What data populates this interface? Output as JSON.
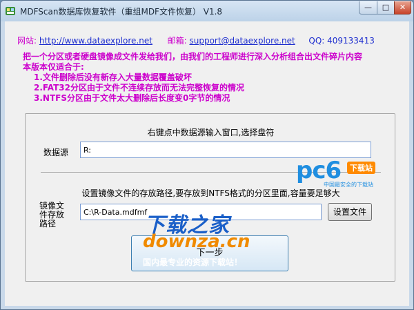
{
  "window": {
    "title": "MDFScan数据库恢复软件（重组MDF文件恢复） V1.8",
    "controls": {
      "minimize": "—",
      "maximize": "□",
      "close": "✕"
    }
  },
  "contact": {
    "website_label": "网站:",
    "website": "http://www.dataexplore.net",
    "email_label": "邮箱:",
    "email": "support@dataexplore.net",
    "qq": "QQ:  409133413"
  },
  "intro": {
    "line1": "把一个分区或者硬盘镜像成文件发给我们，由我们的工程师进行深入分析组合出文件碎片内容",
    "line2": "本版本仅适合于:",
    "items": [
      "1.文件删除后没有新存入大量数据覆盖破坏",
      "2.FAT32分区由于文件不连续存放而无法完整恢复的情况",
      "3.NTFS分区由于文件太大删除后长度变0字节的情况"
    ]
  },
  "panel": {
    "hint_source": "右键点中数据源输入窗口,选择盘符",
    "source_label": "数据源",
    "source_value": "R:",
    "hint_path": "设置镜像文件的存放路径,要存放到NTFS格式的分区里面,容量要足够大",
    "path_label": "镜像文件存放路径",
    "path_value": "C:\\R-Data.mdfmf",
    "browse_label": "设置文件",
    "next_label": "下一步"
  },
  "watermarks": {
    "pc6_logo": "pc6",
    "pc6_tag": "下载站",
    "pc6_slogan": "中国最安全的下载站",
    "xzj_line1": "下载之家",
    "xzj_line2": "downza.cn",
    "xzj_line3": "国内最专业的资源下载站！"
  },
  "colors": {
    "magenta": "#cc00cc",
    "link_blue": "#1f2fcf",
    "title_bar": "#c9d9ea"
  }
}
